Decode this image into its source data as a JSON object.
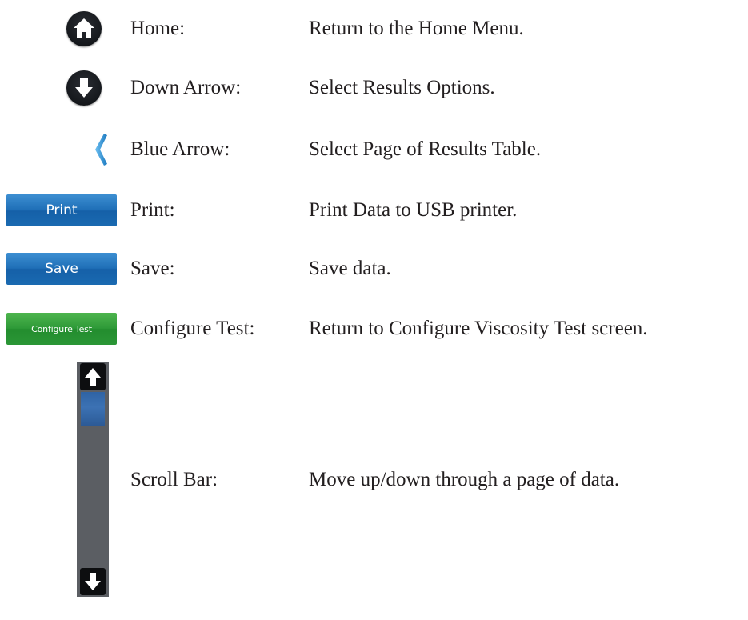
{
  "items": [
    {
      "icon": "home-icon",
      "term": "Home:",
      "description": "Return to the Home Menu."
    },
    {
      "icon": "down-arrow-icon",
      "term": "Down Arrow:",
      "description": "Select Results Options."
    },
    {
      "icon": "blue-arrow-icon",
      "term": "Blue Arrow:",
      "description": "Select Page of Results Table."
    },
    {
      "icon": "print-button",
      "button_label": "Print",
      "term": "Print:",
      "description": "Print Data to USB printer."
    },
    {
      "icon": "save-button",
      "button_label": "Save",
      "term": "Save:",
      "description": "Save data."
    },
    {
      "icon": "configure-test-button",
      "button_label": "Configure Test",
      "term": "Configure Test:",
      "description": "Return to Configure Viscosity Test screen."
    },
    {
      "icon": "scroll-bar",
      "term": "Scroll Bar:",
      "description": "Move up/down through a page of data."
    }
  ],
  "colors": {
    "text": "#231f20",
    "blue_button": "#1f6fb7",
    "green_button": "#2e9a38",
    "chevron": "#3a9ad9",
    "scroll_track": "#5b5e63",
    "dark_icon": "#15181c"
  }
}
